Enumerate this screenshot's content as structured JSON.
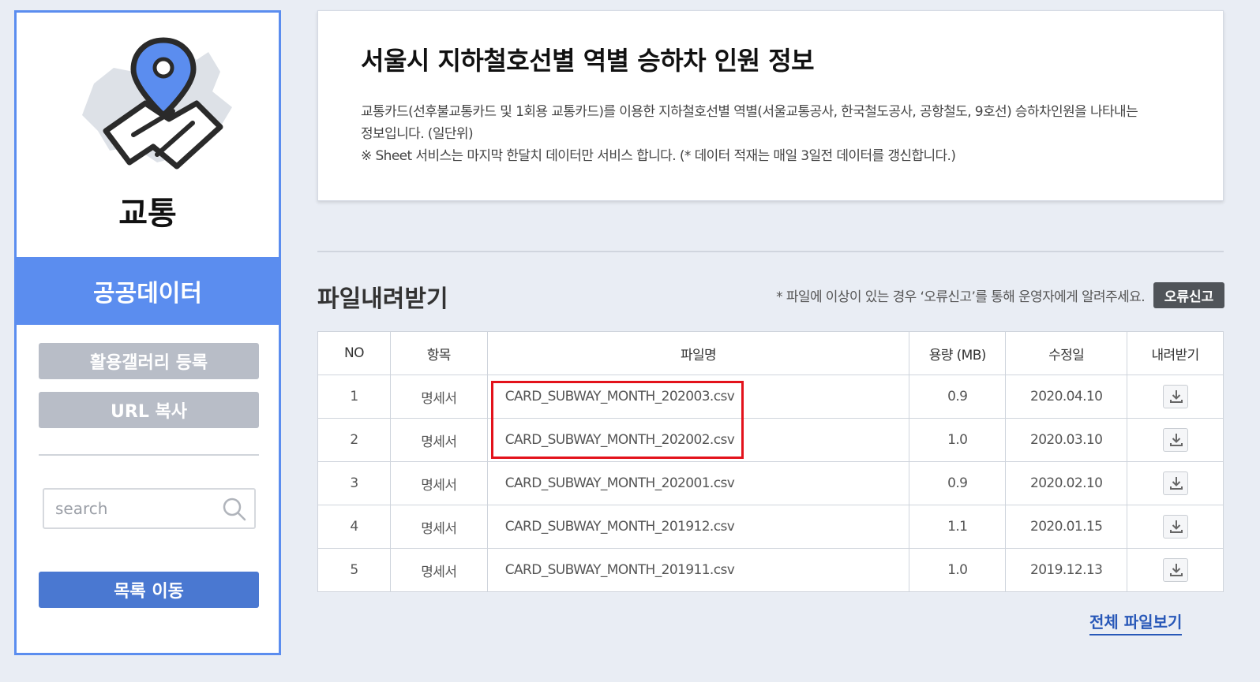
{
  "sidebar": {
    "category": "교통",
    "section_label": "공공데이터",
    "gallery_button": "활용갤러리 등록",
    "url_copy_button": "URL 복사",
    "search_placeholder": "search",
    "list_button": "목록 이동",
    "icon": "map-pin-icon"
  },
  "info": {
    "title": "서울시 지하철호선별 역별 승하차 인원 정보",
    "desc_line1": "교통카드(선후불교통카드 및 1회용 교통카드)를 이용한 지하철호선별 역별(서울교통공사, 한국철도공사, 공항철도, 9호선) 승하차인원을 나타내는",
    "desc_line2": "정보입니다. (일단위)",
    "desc_line3": "※ Sheet 서비스는 마지막 한달치 데이터만 서비스 합니다. (* 데이터 적재는 매일 3일전 데이터를 갱신합니다.)"
  },
  "downloads": {
    "title": "파일내려받기",
    "notice": "* 파일에 이상이 있는 경우 ‘오류신고’를 통해 운영자에게 알려주세요.",
    "report_button": "오류신고",
    "columns": [
      "NO",
      "항목",
      "파일명",
      "용량 (MB)",
      "수정일",
      "내려받기"
    ],
    "rows": [
      {
        "no": "1",
        "item": "명세서",
        "filename": "CARD_SUBWAY_MONTH_202003.csv",
        "size": "0.9",
        "date": "2020.04.10"
      },
      {
        "no": "2",
        "item": "명세서",
        "filename": "CARD_SUBWAY_MONTH_202002.csv",
        "size": "1.0",
        "date": "2020.03.10"
      },
      {
        "no": "3",
        "item": "명세서",
        "filename": "CARD_SUBWAY_MONTH_202001.csv",
        "size": "0.9",
        "date": "2020.02.10"
      },
      {
        "no": "4",
        "item": "명세서",
        "filename": "CARD_SUBWAY_MONTH_201912.csv",
        "size": "1.1",
        "date": "2020.01.15"
      },
      {
        "no": "5",
        "item": "명세서",
        "filename": "CARD_SUBWAY_MONTH_201911.csv",
        "size": "1.0",
        "date": "2019.12.13"
      }
    ],
    "view_all_link": "전체 파일보기"
  },
  "colors": {
    "accent": "#5b8def",
    "button_blue": "#4a78d1",
    "button_gray": "#b8bdc7",
    "highlight": "#e3121b",
    "link": "#2858b8"
  }
}
